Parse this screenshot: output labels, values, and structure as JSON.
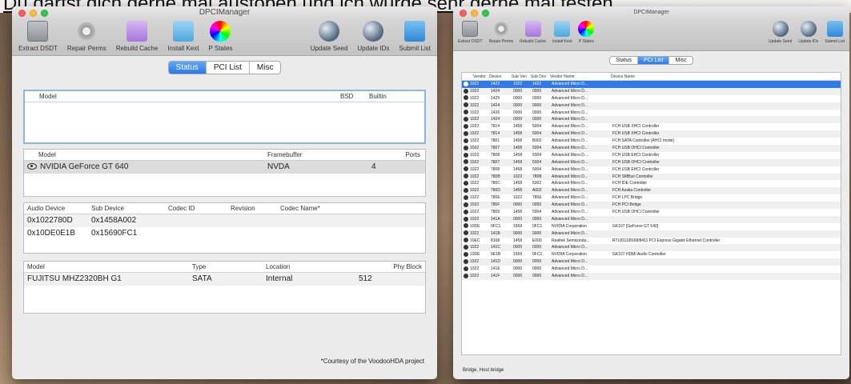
{
  "caption": "Du darfst dich gerne mal austoben und ich würde sehr gerne mal testen.",
  "left": {
    "title": "DPCIManager",
    "toolbar": [
      {
        "label": "Extract DSDT",
        "icon": "drive-icon"
      },
      {
        "label": "Repair Perms",
        "icon": "gear-icon"
      },
      {
        "label": "Rebuild Cache",
        "icon": "folder-icon"
      },
      {
        "label": "Install Kext",
        "icon": "kext-icon"
      },
      {
        "label": "P States",
        "icon": "color-wheel-icon"
      },
      {
        "label": "Update Seed",
        "icon": "globe-icon"
      },
      {
        "label": "Update IDs",
        "icon": "globe-icon"
      },
      {
        "label": "Submit List",
        "icon": "cloud-icon"
      }
    ],
    "tabs": [
      "Status",
      "PCI List",
      "Misc"
    ],
    "active_tab": "Status",
    "disk_table": {
      "headers": [
        "Model",
        "BSD",
        "Builtin"
      ]
    },
    "gpu_table": {
      "headers": [
        "Model",
        "Framebuffer",
        "Ports"
      ],
      "rows": [
        [
          "NVIDIA GeForce GT 640",
          "NVDA",
          "4"
        ]
      ]
    },
    "audio_table": {
      "headers": [
        "Audio Device",
        "Sub Device",
        "Codec ID",
        "Revision",
        "Codec Name*"
      ],
      "rows": [
        [
          "0x1022780D",
          "0x1458A002",
          "",
          "",
          ""
        ],
        [
          "0x10DE0E1B",
          "0x15690FC1",
          "",
          "",
          ""
        ]
      ]
    },
    "storage_table": {
      "headers": [
        "Model",
        "Type",
        "Location",
        "Phy Block"
      ],
      "rows": [
        [
          "FUJITSU MHZ2320BH G1",
          "SATA",
          "Internal",
          "512"
        ]
      ]
    },
    "courtesy": "*Courtesy of the VoodooHDA project"
  },
  "right": {
    "title": "DPCIManager",
    "toolbar": [
      {
        "label": "Extract DSDT",
        "icon": "drive-icon"
      },
      {
        "label": "Repair Perms",
        "icon": "gear-icon"
      },
      {
        "label": "Rebuild Cache",
        "icon": "folder-icon"
      },
      {
        "label": "Install Kext",
        "icon": "kext-icon"
      },
      {
        "label": "P States",
        "icon": "color-wheel-icon"
      },
      {
        "label": "Update Seed",
        "icon": "globe-icon"
      },
      {
        "label": "Update IDs",
        "icon": "globe-icon"
      },
      {
        "label": "Submit List",
        "icon": "cloud-icon"
      }
    ],
    "tabs": [
      "Status",
      "PCI List",
      "Misc"
    ],
    "active_tab": "PCI List",
    "headers": [
      "Vendor",
      "Device",
      "Sub Ven",
      "Sub Dev",
      "Vendor Name",
      "Device Name"
    ],
    "rows": [
      [
        "1022",
        "1422",
        "1022",
        "1422",
        "Advanced Micro D...",
        ""
      ],
      [
        "1022",
        "1424",
        "0000",
        "0000",
        "Advanced Micro D...",
        ""
      ],
      [
        "1022",
        "1425",
        "0000",
        "0000",
        "Advanced Micro D...",
        ""
      ],
      [
        "1022",
        "1424",
        "0000",
        "0000",
        "Advanced Micro D...",
        ""
      ],
      [
        "1022",
        "1426",
        "0000",
        "0000",
        "Advanced Micro D...",
        ""
      ],
      [
        "1022",
        "1424",
        "0000",
        "0000",
        "Advanced Micro D...",
        ""
      ],
      [
        "1022",
        "7814",
        "1458",
        "5004",
        "Advanced Micro D...",
        "FCH USB XHCI Controller"
      ],
      [
        "1022",
        "7814",
        "1458",
        "5004",
        "Advanced Micro D...",
        "FCH USB XHCI Controller"
      ],
      [
        "1022",
        "7801",
        "1458",
        "B002",
        "Advanced Micro D...",
        "FCH SATA Controller [AHCI mode]"
      ],
      [
        "1022",
        "7807",
        "1458",
        "5004",
        "Advanced Micro D...",
        "FCH USB OHCI Controller"
      ],
      [
        "1022",
        "7808",
        "1458",
        "5004",
        "Advanced Micro D...",
        "FCH USB EHCI Controller"
      ],
      [
        "1022",
        "7807",
        "1458",
        "5004",
        "Advanced Micro D...",
        "FCH USB OHCI Controller"
      ],
      [
        "1022",
        "7808",
        "1458",
        "5004",
        "Advanced Micro D...",
        "FCH USB EHCI Controller"
      ],
      [
        "1022",
        "780B",
        "1022",
        "780B",
        "Advanced Micro D...",
        "FCH SMBus Controller"
      ],
      [
        "1022",
        "780C",
        "1458",
        "5002",
        "Advanced Micro D...",
        "FCH IDE Controller"
      ],
      [
        "1022",
        "780D",
        "1458",
        "A002",
        "Advanced Micro D...",
        "FCH Azalia Controller"
      ],
      [
        "1022",
        "780E",
        "1022",
        "780E",
        "Advanced Micro D...",
        "FCH LPC Bridge"
      ],
      [
        "1022",
        "780F",
        "0000",
        "0000",
        "Advanced Micro D...",
        "FCH PCI Bridge"
      ],
      [
        "1022",
        "7809",
        "1458",
        "5004",
        "Advanced Micro D...",
        "FCH USB OHCI Controller"
      ],
      [
        "1022",
        "141A",
        "0000",
        "0000",
        "Advanced Micro D...",
        ""
      ],
      [
        "10DE",
        "0FC1",
        "1569",
        "0FC1",
        "NVIDIA Corporation",
        "GK107 [GeForce GT 640]"
      ],
      [
        "1022",
        "141B",
        "0000",
        "0000",
        "Advanced Micro D...",
        ""
      ],
      [
        "10EC",
        "8168",
        "1458",
        "E000",
        "Realtek Semicondu...",
        "RTL8111/8168/8411 PCI Express Gigabit Ethernet Controller"
      ],
      [
        "1022",
        "141C",
        "0000",
        "0000",
        "Advanced Micro D...",
        ""
      ],
      [
        "10DE",
        "0E1B",
        "1569",
        "0FC1",
        "NVIDIA Corporation",
        "GK107 HDMI Audio Controller"
      ],
      [
        "1022",
        "141D",
        "0000",
        "0000",
        "Advanced Micro D...",
        ""
      ],
      [
        "1022",
        "141E",
        "0000",
        "0000",
        "Advanced Micro D...",
        ""
      ],
      [
        "1022",
        "141F",
        "0000",
        "0000",
        "Advanced Micro D...",
        ""
      ]
    ],
    "selected_row": 0,
    "status_text": "Bridge, Host bridge"
  }
}
